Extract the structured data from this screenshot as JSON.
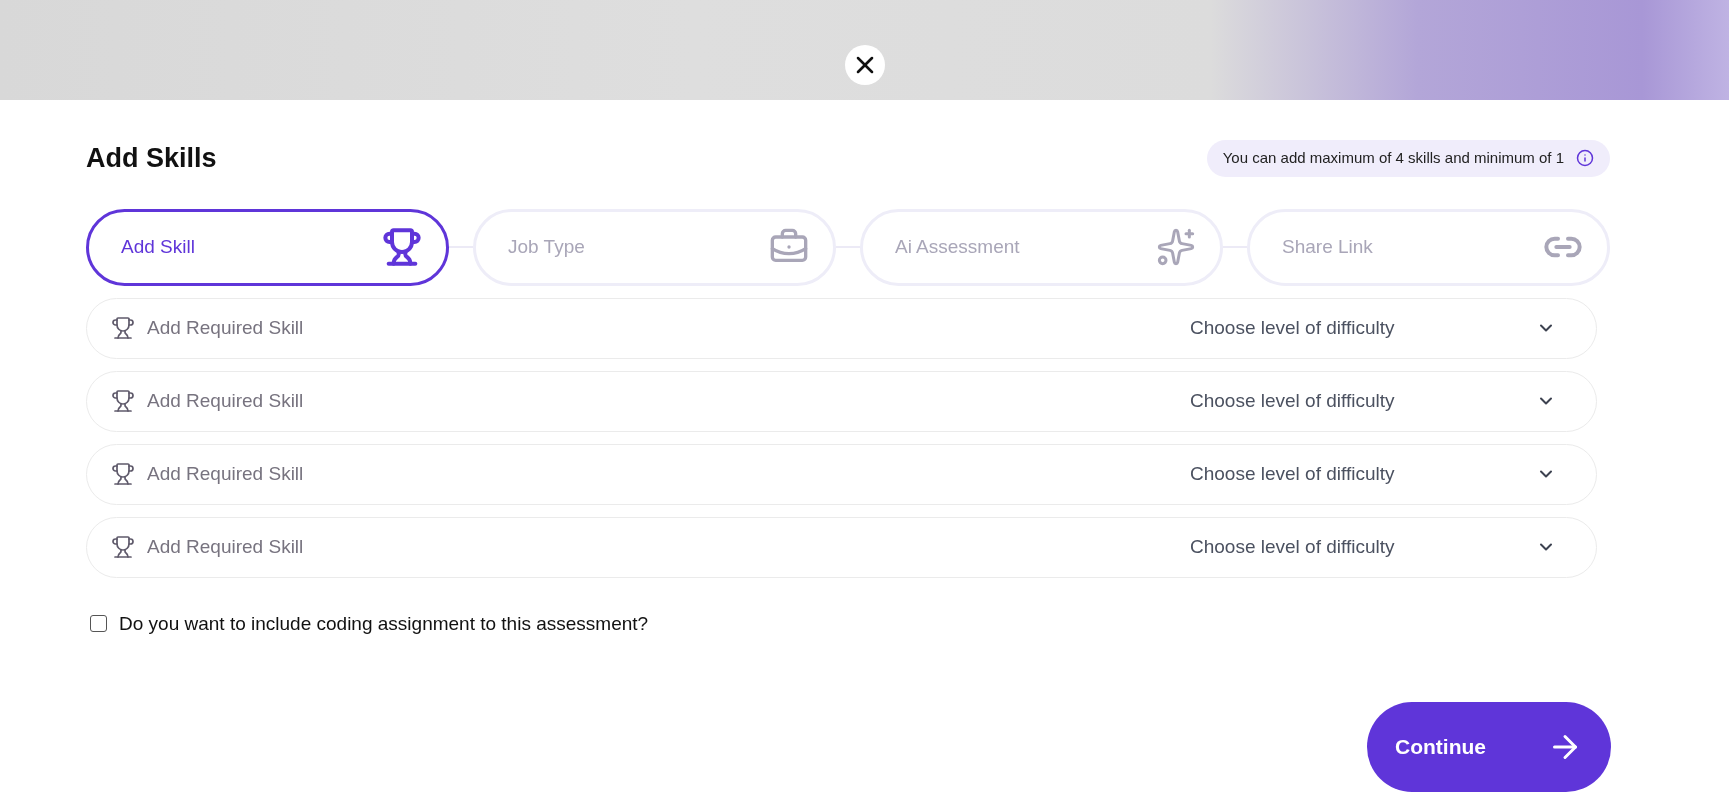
{
  "title": "Add Skills",
  "notice": "You can add maximum of 4 skills and minimum of 1",
  "steps": [
    {
      "label": "Add Skill",
      "kind": "trophy",
      "selected": true
    },
    {
      "label": "Job Type",
      "kind": "bag",
      "selected": false
    },
    {
      "label": "Ai Assessment",
      "kind": "sparkles",
      "selected": false
    },
    {
      "label": "Share Link",
      "kind": "link",
      "selected": false
    }
  ],
  "skill_rows": [
    {
      "placeholder": "Add Required Skill",
      "difficulty": "Choose level of difficulty"
    },
    {
      "placeholder": "Add Required Skill",
      "difficulty": "Choose level of difficulty"
    },
    {
      "placeholder": "Add Required Skill",
      "difficulty": "Choose level of difficulty"
    },
    {
      "placeholder": "Add Required Skill",
      "difficulty": "Choose level of difficulty"
    }
  ],
  "coding_assignment": {
    "label": "Do you want to include coding assignment to this assessment?",
    "checked": false
  },
  "continue_button": "Continue"
}
